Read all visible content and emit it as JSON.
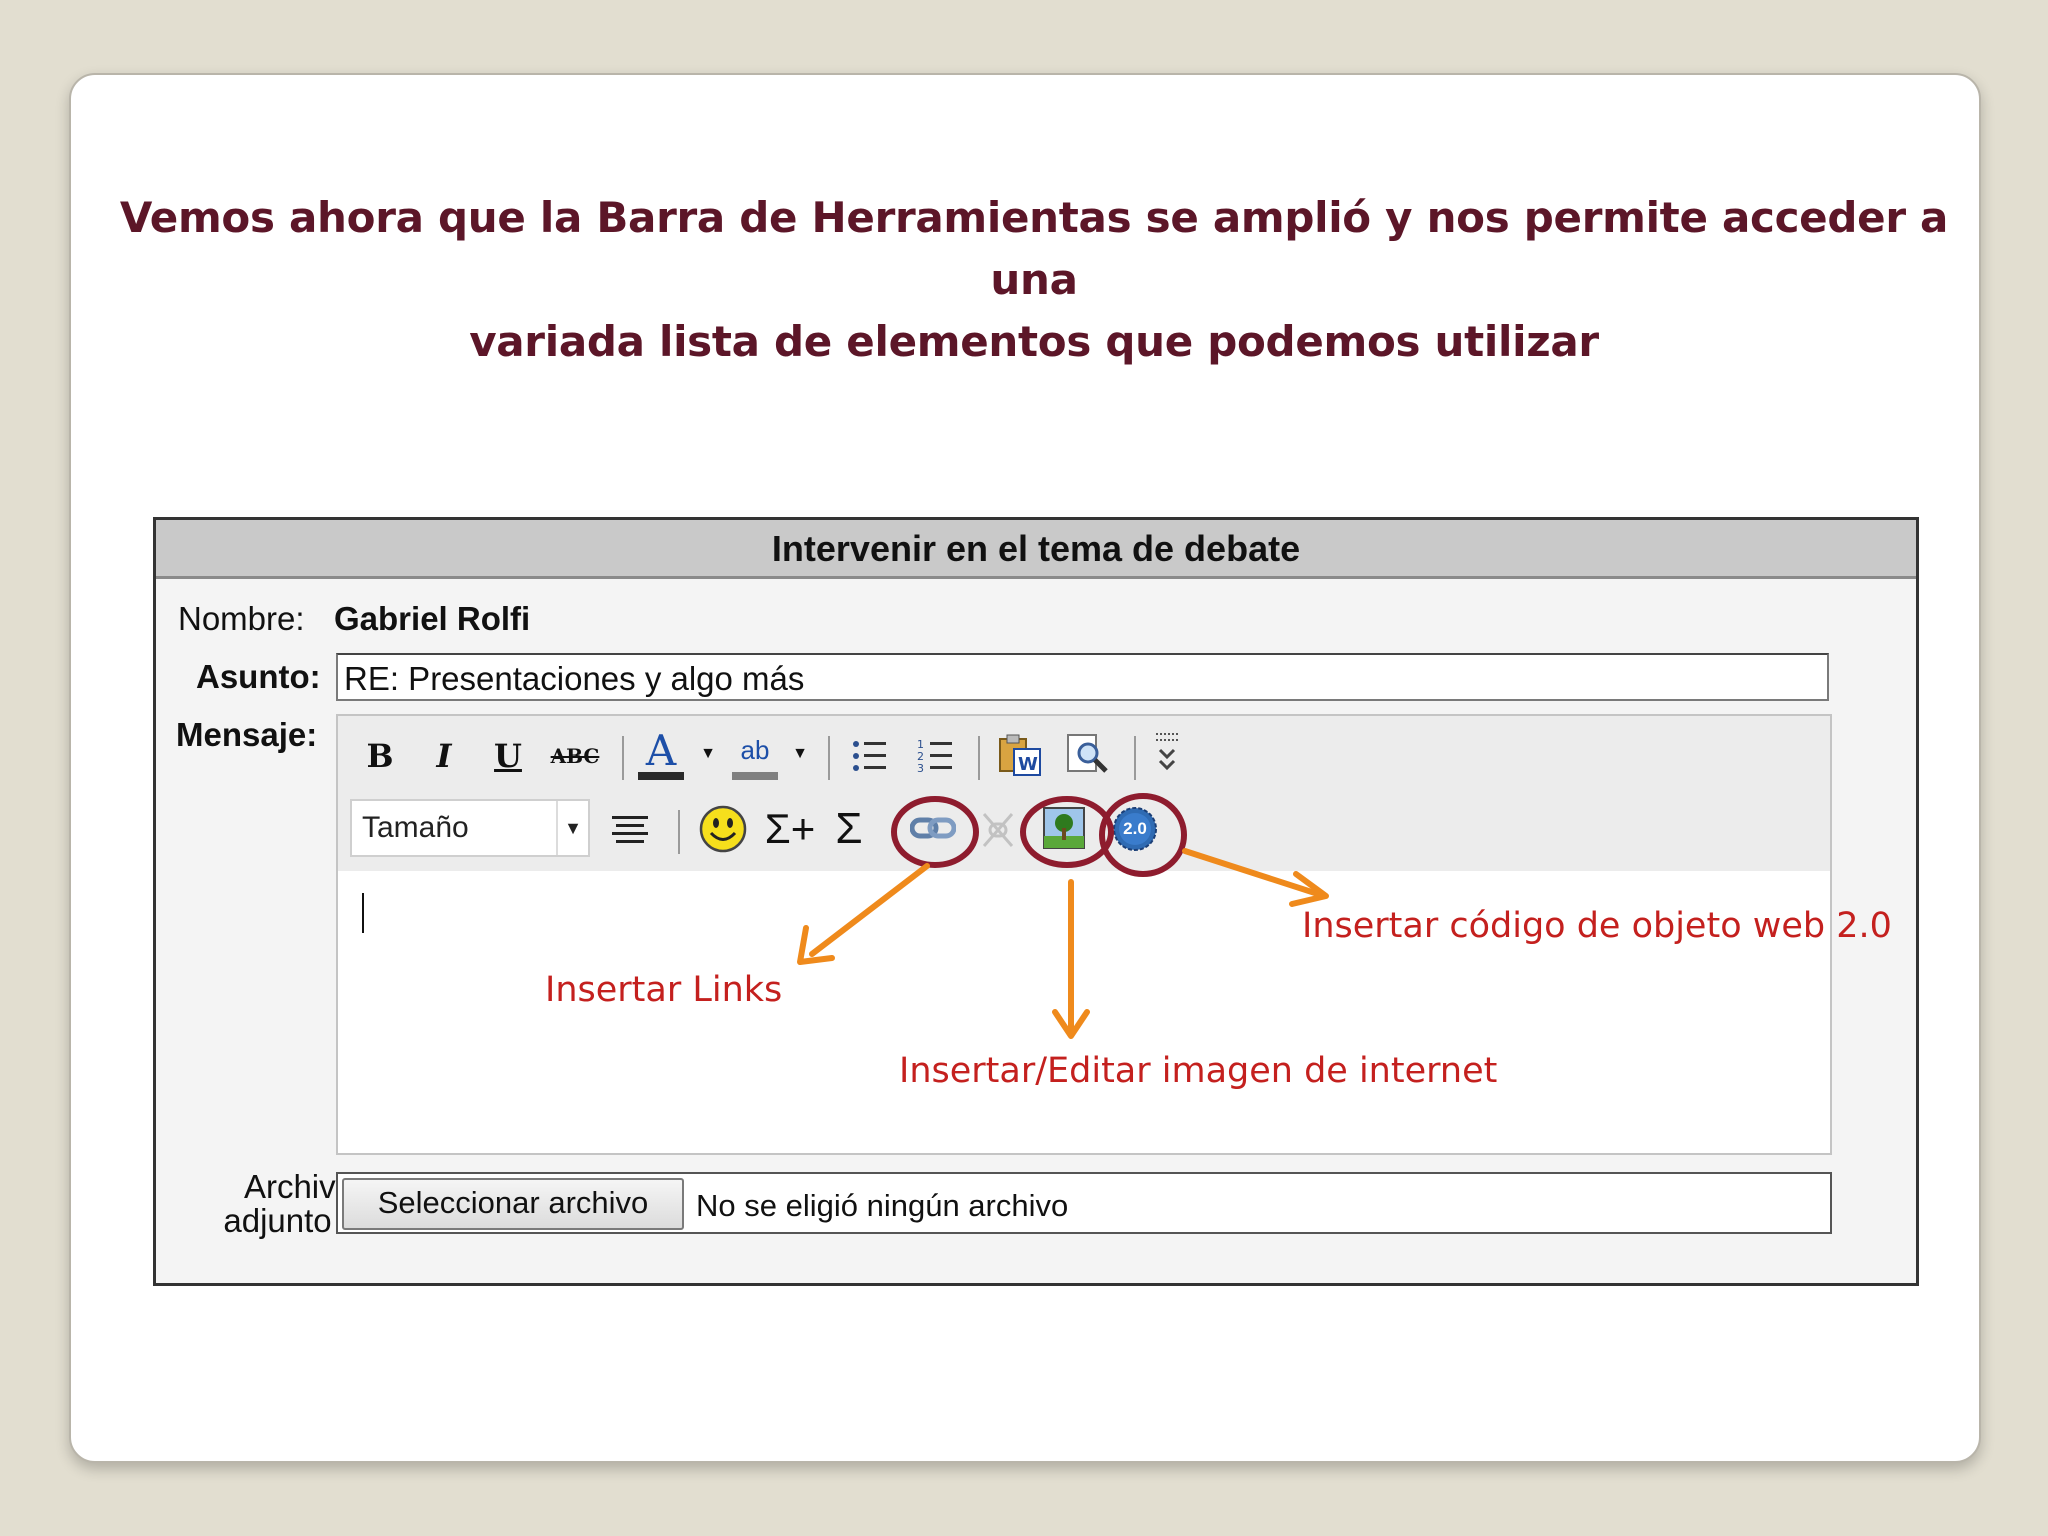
{
  "slide": {
    "heading_line1": "Vemos ahora que la Barra de Herramientas se amplió y nos permite acceder a una",
    "heading_line2": "variada lista de elementos que podemos utilizar",
    "heading_color": "#5c1628"
  },
  "form": {
    "title": "Intervenir en el tema de debate",
    "name_label": "Nombre:",
    "name_value": "Gabriel Rolfi",
    "subject_label": "Asunto:",
    "subject_value": "RE: Presentaciones y algo más",
    "message_label": "Mensaje:",
    "attachment_label_line1": "Archivo",
    "attachment_label_line2": "adjunto :",
    "file_button": "Seleccionar archivo",
    "file_status": "No se eligió ningún archivo"
  },
  "toolbar": {
    "row1": [
      "bold-icon",
      "italic-icon",
      "underline-icon",
      "strikethrough-icon",
      "font-color-icon",
      "highlight-color-icon",
      "bulleted-list-icon",
      "numbered-list-icon",
      "paste-from-word-icon",
      "find-icon",
      "more-tools-icon"
    ],
    "bold": "B",
    "italic": "I",
    "underline": "U",
    "strike": "ABC",
    "font_color": "A",
    "highlight": "ab",
    "size_select": "Tamaño",
    "equation1": "Σ+",
    "equation2": "Σ",
    "web20": "2.0"
  },
  "annotations": {
    "links": "Insertar Links",
    "image": "Insertar/Editar imagen de internet",
    "web20": "Insertar código de objeto web 2.0",
    "color": "#c4201e",
    "arrow_color": "#ef8a1c",
    "circle_color": "#8e1c2e"
  }
}
